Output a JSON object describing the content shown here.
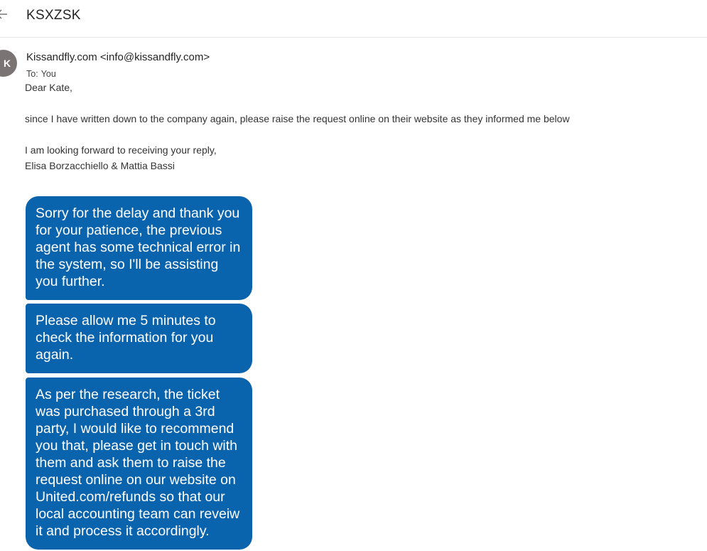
{
  "header": {
    "subject": "KSXZSK"
  },
  "message": {
    "avatar_initial": "K",
    "sender": "Kissandfly.com <info@kissandfly.com>",
    "to_label": "To:",
    "to_value": "You"
  },
  "body": {
    "greeting": "Dear Kate,",
    "paragraph1": "since I have written down to the company again, please raise the request online on their website as they informed me below",
    "paragraph2": "I am looking forward to receiving your reply,",
    "signature": "Elisa Borzacchiello & Mattia Bassi"
  },
  "chat_bubbles": [
    "Sorry for the delay and thank you for your patience, the previous agent has some technical error in the system, so I'll be assisting you further.",
    "Please allow me 5 minutes to check the information for you again.",
    "As per the research, the ticket was purchased through a 3rd party, I would like to recommend you that, please get in touch with them and ask them to raise the request online on our website on United.com/refunds so that our local accounting team can reveiw it and process it accordingly."
  ],
  "colors": {
    "bubble_background": "#0a63ad",
    "bubble_text": "#ffffff",
    "avatar_background": "#7a7574"
  }
}
